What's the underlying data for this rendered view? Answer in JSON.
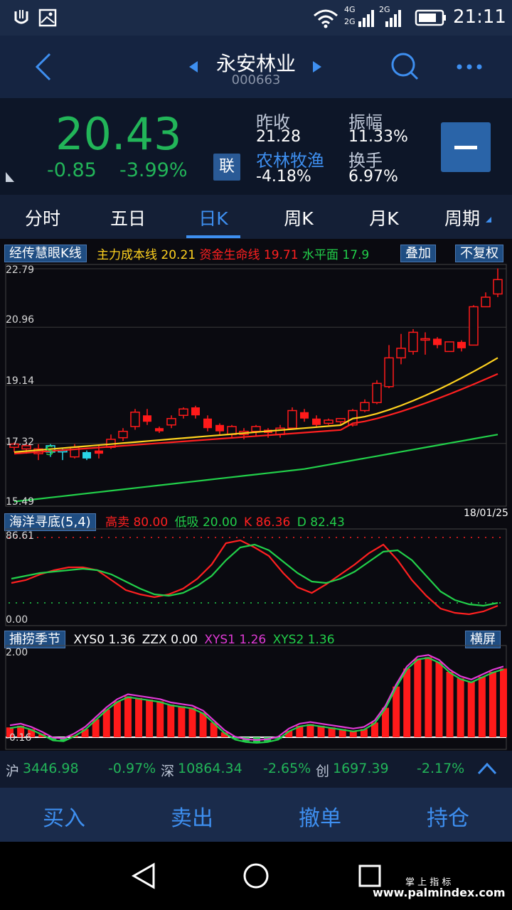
{
  "status": {
    "time": "21:11",
    "net1": "4G",
    "net2": "2G",
    "net3": "2G",
    "net4": "2G"
  },
  "nav": {
    "stock_name": "永安林业",
    "stock_code": "000663"
  },
  "quote": {
    "price": "20.43",
    "change": "-0.85",
    "change_pct": "-3.99%",
    "lian_label": "联",
    "prev_close_label": "昨收",
    "prev_close": "21.28",
    "sector_label": "农林牧渔",
    "sector_change": "-4.18%",
    "amplitude_label": "振幅",
    "amplitude": "11.33%",
    "turnover_label": "换手",
    "turnover": "6.97%"
  },
  "tabs": [
    {
      "label": "分时"
    },
    {
      "label": "五日"
    },
    {
      "label": "日K"
    },
    {
      "label": "周K"
    },
    {
      "label": "月K"
    },
    {
      "label": "周期"
    }
  ],
  "main_chart": {
    "indicator_name": "经传慧眼K线",
    "ma1_label": "主力成本线",
    "ma1_value": "20.21",
    "ma2_label": "资金生命线",
    "ma2_value": "19.71",
    "ma3_label": "水平面",
    "ma3_value": "17.9",
    "overlay_button": "叠加",
    "adjust_button": "不复权",
    "y_ticks": [
      "22.79",
      "20.96",
      "19.14",
      "17.32",
      "15.49"
    ],
    "date": "18/01/25"
  },
  "osc1": {
    "name": "海洋寻底(5,4)",
    "high_label": "高卖",
    "high_value": "80.00",
    "low_label": "低吸",
    "low_value": "20.00",
    "k_label": "K",
    "k_value": "86.36",
    "d_label": "D",
    "d_value": "82.43",
    "y_top": "86.61",
    "y_bottom": "0.00"
  },
  "osc2": {
    "name": "捕捞季节",
    "xys0_label": "XYS0",
    "xys0_value": "1.36",
    "zzx_label": "ZZX",
    "zzx_value": "0.00",
    "xys1_label": "XYS1",
    "xys1_value": "1.26",
    "xys2_label": "XYS2",
    "xys2_value": "1.36",
    "landscape_button": "横屏",
    "y_top": "2.00",
    "y_bottom": "-0.16"
  },
  "index_bar": {
    "sh_label": "沪",
    "sh_value": "3446.98",
    "sh_pct": "-0.97%",
    "sz_label": "深",
    "sz_value": "10864.34",
    "sz_pct": "-2.65%",
    "cy_label": "创",
    "cy_value": "1697.39",
    "cy_pct": "-2.17%"
  },
  "trade": {
    "buy": "买入",
    "sell": "卖出",
    "cancel": "撤单",
    "position": "持仓"
  },
  "watermark": {
    "line1": "掌 上 指 标",
    "line2": "www.palmindex.com"
  },
  "colors": {
    "up": "#ff1a1a",
    "down": "#22c55e",
    "accent": "#3e8ff0",
    "yellow": "#ffd21f",
    "purple": "#e03ad6"
  }
}
